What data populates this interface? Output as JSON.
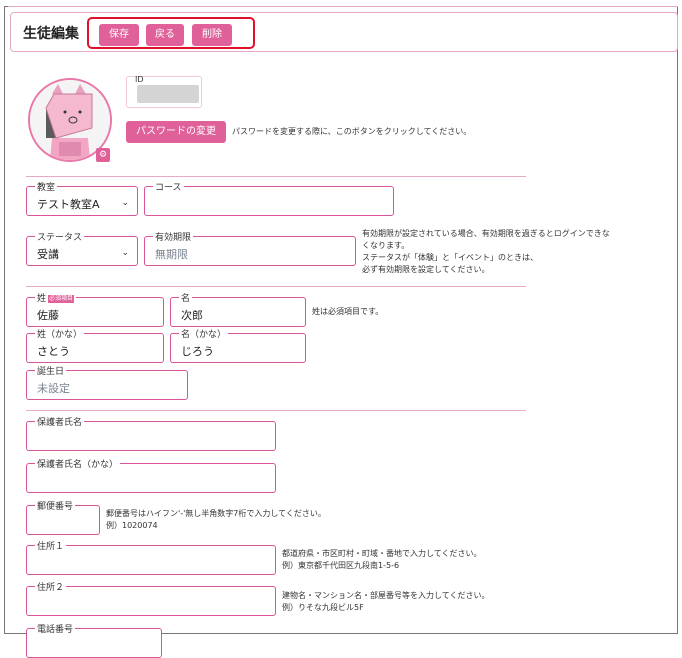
{
  "header": {
    "title": "生徒編集",
    "buttons": {
      "save": "保存",
      "back": "戻る",
      "delete": "削除"
    }
  },
  "profile": {
    "id_label": "ID",
    "password_button": "パスワードの変更",
    "password_note": "パスワードを変更する際に、このボタンをクリックしてください。"
  },
  "classroom": {
    "label": "教室",
    "value": "テスト教室A"
  },
  "course": {
    "label": "コース",
    "value": ""
  },
  "status": {
    "label": "ステータス",
    "value": "受講"
  },
  "expiry": {
    "label": "有効期限",
    "value": "無期限",
    "note": [
      "有効期限が設定されている場合、有効期限を過ぎるとログインできな",
      "くなります。",
      "ステータスが「体験」と「イベント」のときは、",
      "必ず有効期限を設定してください。"
    ]
  },
  "name": {
    "last_label": "姓",
    "required_badge": "必須項目",
    "last_value": "佐藤",
    "first_label": "名",
    "first_value": "次郎",
    "note": "姓は必須項目です。",
    "last_kana_label": "姓（かな）",
    "last_kana_value": "さとう",
    "first_kana_label": "名（かな）",
    "first_kana_value": "じろう"
  },
  "birthday": {
    "label": "誕生日",
    "value": "未設定"
  },
  "guardian": {
    "name_label": "保護者氏名",
    "name_value": "",
    "kana_label": "保護者氏名（かな）",
    "kana_value": ""
  },
  "postal": {
    "label": "郵便番号",
    "value": "",
    "note": [
      "郵便番号はハイフン'-'無し半角数字7桁で入力してください。",
      "例）1020074"
    ]
  },
  "address1": {
    "label": "住所１",
    "value": "",
    "note": [
      "都道府県・市区町村・町域・番地で入力してください。",
      "例）東京都千代田区九段南1-5-6"
    ]
  },
  "address2": {
    "label": "住所２",
    "value": "",
    "note": [
      "建物名・マンション名・部屋番号等を入力してください。",
      "例）りそな九段ビル5F"
    ]
  },
  "phone": {
    "label": "電話番号"
  },
  "colors": {
    "accent": "#e0609a",
    "highlight": "#e0102a",
    "field_border": "#d8559a"
  }
}
